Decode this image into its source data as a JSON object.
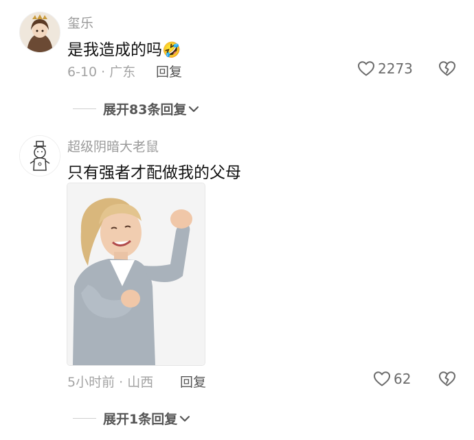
{
  "comments": [
    {
      "username": "玺乐",
      "text": "是我造成的吗",
      "emoji": "🤣",
      "meta": "6-10 · 广东",
      "reply_label": "回复",
      "likes": "2273",
      "expand_label": "展开83条回复"
    },
    {
      "username": "超级阴暗大老鼠",
      "text": "只有强者才配做我的父母",
      "meta": "5小时前 · 山西",
      "reply_label": "回复",
      "likes": "62",
      "expand_label": "展开1条回复"
    }
  ],
  "icons": {
    "like": "heart-outline-icon",
    "dislike": "broken-heart-icon",
    "expand": "chevron-down-icon"
  },
  "colors": {
    "username": "#9a9a9a",
    "text": "#111111",
    "meta": "#a3a3a3",
    "action": "#555555"
  }
}
